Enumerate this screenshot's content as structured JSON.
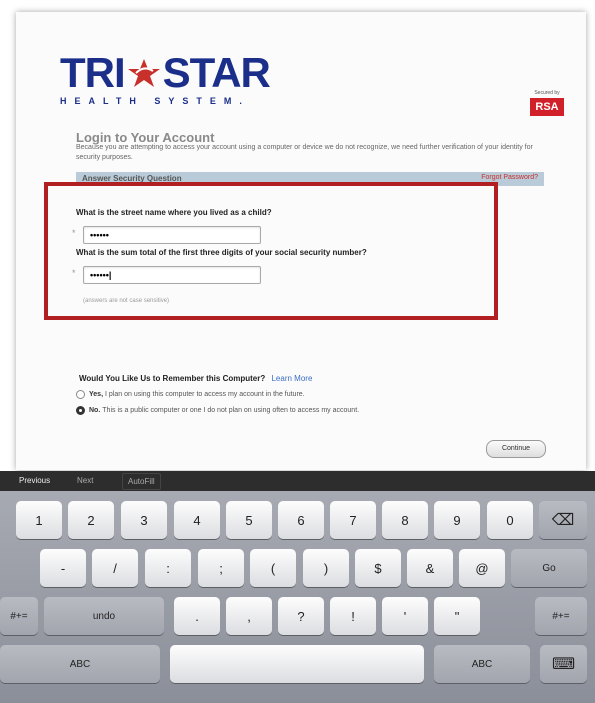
{
  "logo": {
    "wordmark_left": "TRI",
    "wordmark_right": "STAR",
    "subtitle": "HEALTH SYSTEM."
  },
  "rsa": {
    "small": "Secured by",
    "label": "RSA"
  },
  "page": {
    "title": "Login to Your Account",
    "description": "Because you are attempting to access your account using a computer or device we do not recognize, we need further verification of your identity for security purposes.",
    "section_label": "Answer Security Question",
    "section_link": "Forgot Password?"
  },
  "questions": [
    {
      "asterisk": "*",
      "label": "What is the street name where you lived as a child?",
      "value": "••••••"
    },
    {
      "asterisk": "*",
      "label": "What is the sum total of the first three digits of your social security number?",
      "value": "••••••|"
    }
  ],
  "hint": "(answers are not case sensitive)",
  "remember": {
    "question": "Would You Like Us to Remember this Computer?",
    "learn_more": "Learn More",
    "yes_bold": "Yes,",
    "yes_text": "I plan on using this computer to access my account in the future.",
    "no_bold": "No.",
    "no_text": "This is a public computer or one I do not plan on using often to access my account.",
    "selected": "no"
  },
  "continue_label": "Continue",
  "keyboard_bar": {
    "previous": "Previous",
    "next": "Next",
    "autofill": "AutoFill"
  },
  "keyboard": {
    "row1": [
      "1",
      "2",
      "3",
      "4",
      "5",
      "6",
      "7",
      "8",
      "9",
      "0"
    ],
    "row1_delete": "⌫",
    "row2": [
      "-",
      "/",
      ":",
      ";",
      "(",
      ")",
      "$",
      "&",
      "@"
    ],
    "row2_go": "Go",
    "row3_shift_left": "#+=",
    "row3_undo": "undo",
    "row3": [
      ".",
      ",",
      "?",
      "!",
      "'",
      "\""
    ],
    "row3_shift_right": "#+=",
    "row4_abc_left": "ABC",
    "row4_abc_right": "ABC",
    "row4_hide": "⌨"
  }
}
